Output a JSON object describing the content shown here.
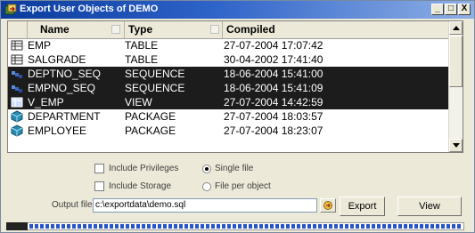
{
  "window": {
    "title": "Export User Objects of DEMO",
    "minimize_label": "_",
    "maximize_label": "□",
    "close_label": "X"
  },
  "table": {
    "columns": [
      "Name",
      "Type",
      "Compiled"
    ],
    "rows": [
      {
        "icon": "table-icon",
        "name": "EMP",
        "type": "TABLE",
        "compiled": "27-07-2004 17:07:42",
        "selected": false
      },
      {
        "icon": "table-icon",
        "name": "SALGRADE",
        "type": "TABLE",
        "compiled": "30-04-2002 17:41:40",
        "selected": false
      },
      {
        "icon": "sequence-icon",
        "name": "DEPTNO_SEQ",
        "type": "SEQUENCE",
        "compiled": "18-06-2004 15:41:00",
        "selected": true
      },
      {
        "icon": "sequence-icon",
        "name": "EMPNO_SEQ",
        "type": "SEQUENCE",
        "compiled": "18-06-2004 15:41:09",
        "selected": true
      },
      {
        "icon": "view-icon",
        "name": "V_EMP",
        "type": "VIEW",
        "compiled": "27-07-2004 14:42:59",
        "selected": true
      },
      {
        "icon": "package-icon",
        "name": "DEPARTMENT",
        "type": "PACKAGE",
        "compiled": "27-07-2004 18:03:57",
        "selected": false
      },
      {
        "icon": "package-icon",
        "name": "EMPLOYEE",
        "type": "PACKAGE",
        "compiled": "27-07-2004 18:23:07",
        "selected": false
      }
    ]
  },
  "options": {
    "include_privileges": "Include Privileges",
    "include_storage": "Include Storage",
    "single_file": "Single file",
    "file_per_object": "File per object",
    "file_mode_selected": "Single file"
  },
  "output": {
    "label": "Output file",
    "value": "c:\\exportdata\\demo.sql"
  },
  "buttons": {
    "export": "Export",
    "view": "View"
  },
  "progress": {
    "fraction": 1.0
  },
  "colors": {
    "title_start": "#0a3b9c",
    "selection": "#1c1c1c",
    "progress": "#2a55c8"
  }
}
